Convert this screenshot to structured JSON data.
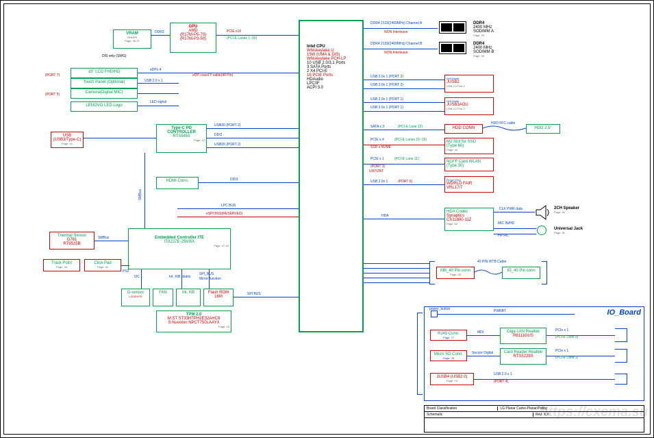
{
  "left": {
    "vram": {
      "title": "VRAM",
      "sub": "GDDR5",
      "page": "Page: 36-37"
    },
    "gpu": {
      "title": "GPU",
      "sub1": "AMD",
      "sub2": "(R17M-P5-70)",
      "sub3": "(R17M-P3-50)"
    },
    "dis_only": "DIS only (SWG)",
    "port7": "(PORT 7)",
    "port5": "(PORT 5)",
    "lcd": "15\" LCD FHD/HD",
    "touch": "Touch Panel (Optional)",
    "camera": "Camera(Digital MIC)",
    "logo": "LENOVO LED Logo",
    "edp_cable": "eDP coaxil Y cable(40 Pin)",
    "usb_port1": "USB 2.0 x 1",
    "led_signal": "LED signal",
    "typec": {
      "title": "Type-C PD CONTROLLER",
      "chip": "RTS5455",
      "page": "Page: 42"
    },
    "usb_typec": {
      "title": "USB",
      "sub": "(USB3/Type-C)",
      "page": "Page: 41"
    },
    "hdmi": "HDMI Conn.",
    "thermal": {
      "title": "Thermal Sensor",
      "sub": "G781",
      "chip": "RT9525B"
    },
    "trackpoint": {
      "title": "Track Point",
      "page": "Page: 40"
    },
    "clickpad": {
      "title": "Click Pad",
      "page": "Page: 40"
    },
    "ec": {
      "title": "Embedded Controller ITE",
      "chip": "IT8227E-256/BX",
      "page": "Page: 47-49"
    },
    "gsensor": {
      "title": "G-sensor",
      "chip": "LIS3DHTR"
    },
    "fan": "FAN",
    "intkb": "Int. KB",
    "flashrom": {
      "title": "Flash ROM 16M"
    },
    "tpm": {
      "title": "TPM 2.0",
      "chip1": "M:ST ST33HTPH2E32AHC8",
      "chip2": "S:Nuvoton NPCT750LAAYX",
      "page": "Page: 43"
    },
    "smbus": "SMBus",
    "i2c": "I2C",
    "kbmatrix": "Int. K/B Matrix",
    "ps2": "PS2",
    "spi_bus": "SPI_BUS",
    "spi_bus2": "SPI BUS",
    "mirror": "Mirror function",
    "lpc_bus": "LPC BUS",
    "espi_bus": "eSPI BUS(RESERVED)"
  },
  "cpu": {
    "title": "Intel CPU",
    "line1": "Whiskeylake U",
    "line2": "15W (UMA & DIS)",
    "line3": "Whiskeylake PCH-LP",
    "line4": "10 USB 2.0/3.1 Ports",
    "line5": "3 SATA Ports",
    "line6": "2 X4 PCI-E",
    "line7": "16 PCIE Ports",
    "line8": "HDAudio",
    "line9": "LPC/IF",
    "line10": "ACPI 3.0"
  },
  "right": {
    "ddr4_a": {
      "title": "DDR4",
      "speed": "2400 MHz",
      "type": "SODIMM A",
      "page": "Page: 29"
    },
    "ddr4_b": {
      "title": "DDR4",
      "speed": "2400 MHz",
      "type": "SODIMM B",
      "page": "Page: 30"
    },
    "ddr_label_a": "DDR4 2133(2400MHz) Channel A",
    "ddr_label_b": "DDR4 2133(2400MHz) Channel B",
    "non_interleave_a": "NON Interleave",
    "non_interleave_b": "NON Interleave",
    "jusb2": {
      "title": "JUSB2",
      "sub": "Self-Made",
      "detail": "USB 2.0 Port 2",
      "page": "Page: 41"
    },
    "jusb3aou": {
      "title": "JUSB3AOU",
      "sub": "Self-Made",
      "detail": "USB 3.0 Port 2",
      "page": "Page: 41"
    },
    "hdd": {
      "conn": "HDD CONN",
      "ffc": "HDD FFC cable",
      "label": "HDD 2.5\""
    },
    "ssd": {
      "title": "M2 Slot for SSD",
      "type": "(Type 80)",
      "page": "Page: 44"
    },
    "wlan": {
      "title": "NGFF Card WLAN",
      "type": "(Type 30)"
    },
    "fp": {
      "sub": "Finger Print",
      "title": "WORLD FAIR",
      "chip": "VRL17/7"
    },
    "hda_codec": {
      "title": "HDA Codec",
      "sub": "Synaptics",
      "chip": "CX11880-11Z",
      "page": "Page: 52"
    },
    "speaker": {
      "title": "2CH Speaker",
      "page": "Page: 52"
    },
    "jack": {
      "title": "Universal Jack",
      "page": "Page: 52"
    },
    "mic": "MIC IN/HD",
    "hprl": "HP R/L",
    "mb40": {
      "title": "MB_40 Pin conn",
      "page": "Page: 45"
    },
    "io40": {
      "title": "IO_40 Pin conn"
    },
    "wtb": "40 PIN WTB Cable",
    "clk_pwr": "CLK PWR data"
  },
  "signals": {
    "pcie_x16": "PCIE x16",
    "pcie_lanes": "(PCI-E Lanes 1~16)",
    "ddr3": "DDR3",
    "edp_x4": "eDPx 4",
    "usb30_p2": "USB30 (PORT 2)",
    "ddi2": "DDI2",
    "usb20_p2": "USB20 (PORT 2)",
    "ddi3": "DDI3",
    "usb20_port2": "USB 2.0x 1 (PORT 2)",
    "usb30_port2": "USB 3.0x 1 (PORT 2)",
    "usb20_port1": "USB 2.0x 1 (PORT 1)",
    "usb30_port1": "USB 3.0x 1 (PORT 1)",
    "sata_x3": "SATA x 3",
    "pcie_lane12": "(PCI-E Lane 12)",
    "pcie_x4": "PCIE x 4",
    "pcie_lanes1516": "(PCI-E Lanes 15~16)",
    "ssd_nvme": "SSD x NVME",
    "pcie_x1_lane11": "PCIE x 1",
    "lane11": "(PCI-E Lane 11)",
    "port_3": "(PORT 3)",
    "usb20_x1": "USB 2.0x 1",
    "port6": "(PORT 6)",
    "hda": "HDA",
    "uwyzbt": "UWYZBT"
  },
  "io_board": {
    "title": "IO_Board",
    "power": "power_button",
    "pwrbt": "PWRBT",
    "rj45": "RJ45 Conn.",
    "mdi": "MDI",
    "lan": {
      "title": "Giga LAN Realtek",
      "chip": "R8111GUS"
    },
    "pcie_x1": "PCIe x 1",
    "pcie_lane9": "(PCI-E Lane 9)",
    "sd": "Micro SD Conn.",
    "secure": "Secure Digital",
    "reader": {
      "title": "Card Reader Realtek",
      "chip": "RTS5229S"
    },
    "pcie_lane1": "(PCI-E Lane 1)",
    "jusb4": {
      "title": "JUSB4 (USB2.0)",
      "page": "Page: 74"
    },
    "usb20_port4": "USB 2.0 x 1",
    "port4_label": "(PORT 4)",
    "page77": "Page: 77",
    "page78": "Page: 78"
  },
  "titleblock": {
    "classification": "Board Classification",
    "desc": "LG Planar Carbo-Planar/Pebby",
    "sheet": "Schematic",
    "rev": "Rev: X.X"
  },
  "watermark": "https://cxema.su"
}
